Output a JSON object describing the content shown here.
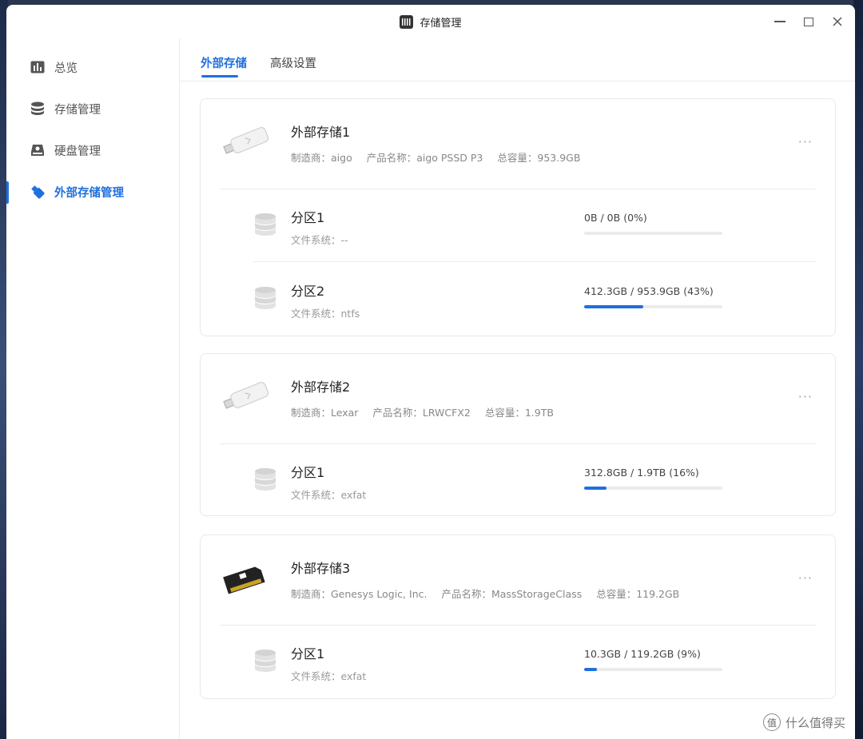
{
  "window": {
    "title": "存储管理"
  },
  "sidebar": {
    "items": [
      {
        "label": "总览",
        "icon": "chart-icon"
      },
      {
        "label": "存储管理",
        "icon": "database-icon"
      },
      {
        "label": "硬盘管理",
        "icon": "hard-disk-icon"
      },
      {
        "label": "外部存储管理",
        "icon": "usb-icon",
        "active": true
      }
    ]
  },
  "tabs": [
    {
      "label": "外部存储",
      "active": true
    },
    {
      "label": "高级设置"
    }
  ],
  "devices": [
    {
      "name": "外部存储1",
      "icon": "usb-drive-icon",
      "manufacturer": "制造商：aigo",
      "product": "产品名称：aigo PSSD P3",
      "capacity": "总容量：953.9GB",
      "more": "···",
      "partitions": [
        {
          "name": "分区1",
          "fs": "文件系统：--",
          "usage": "0B / 0B (0%)",
          "percent": 0
        },
        {
          "name": "分区2",
          "fs": "文件系统：ntfs",
          "usage": "412.3GB / 953.9GB (43%)",
          "percent": 43
        }
      ]
    },
    {
      "name": "外部存储2",
      "icon": "usb-drive-icon",
      "manufacturer": "制造商：Lexar",
      "product": "产品名称：LRWCFX2",
      "capacity": "总容量：1.9TB",
      "more": "···",
      "partitions": [
        {
          "name": "分区1",
          "fs": "文件系统：exfat",
          "usage": "312.8GB / 1.9TB (16%)",
          "percent": 16
        }
      ]
    },
    {
      "name": "外部存储3",
      "icon": "sd-card-icon",
      "manufacturer": "制造商：Genesys Logic, Inc.",
      "product": "产品名称：MassStorageClass",
      "capacity": "总容量：119.2GB",
      "more": "···",
      "partitions": [
        {
          "name": "分区1",
          "fs": "文件系统：exfat",
          "usage": "10.3GB / 119.2GB (9%)",
          "percent": 9
        }
      ]
    }
  ],
  "watermark": {
    "text": "什么值得买",
    "logo": "值"
  },
  "colors": {
    "accent": "#1f6fde"
  }
}
